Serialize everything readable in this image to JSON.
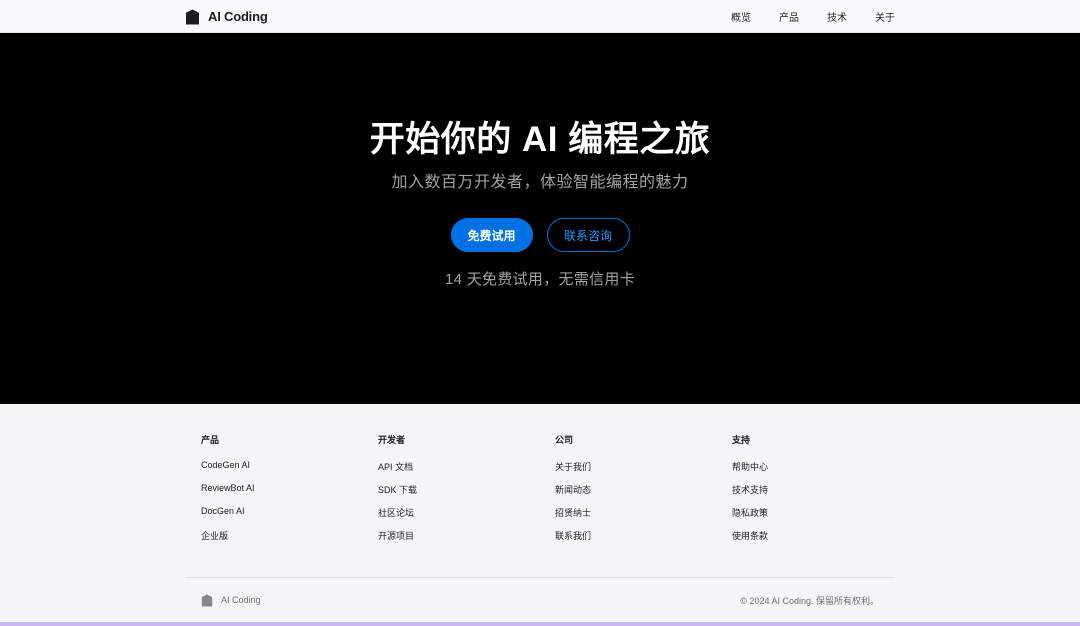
{
  "nav": {
    "brand": "AI Coding",
    "brand_icon": "shield-logo-icon",
    "links": [
      "概览",
      "产品",
      "技术",
      "关于"
    ]
  },
  "hero": {
    "title": "开始你的 AI 编程之旅",
    "subtitle": "加入数百万开发者，体验智能编程的魅力",
    "primary_button": "免费试用",
    "secondary_button": "联系咨询",
    "note": "14 天免费试用，无需信用卡"
  },
  "footer": {
    "columns": [
      {
        "heading": "产品",
        "links": [
          "CodeGen AI",
          "ReviewBot AI",
          "DocGen AI",
          "企业版"
        ]
      },
      {
        "heading": "开发者",
        "links": [
          "API 文档",
          "SDK 下载",
          "社区论坛",
          "开源项目"
        ]
      },
      {
        "heading": "公司",
        "links": [
          "关于我们",
          "新闻动态",
          "招贤纳士",
          "联系我们"
        ]
      },
      {
        "heading": "支持",
        "links": [
          "帮助中心",
          "技术支持",
          "隐私政策",
          "使用条款"
        ]
      }
    ],
    "brand": "AI Coding",
    "copyright": "© 2024 AI Coding. 保留所有权利。"
  },
  "colors": {
    "accent": "#0071e3",
    "hero_background": "#000000",
    "page_background": "#f5f5f7",
    "bottom_strip": "#c9b8f0"
  }
}
